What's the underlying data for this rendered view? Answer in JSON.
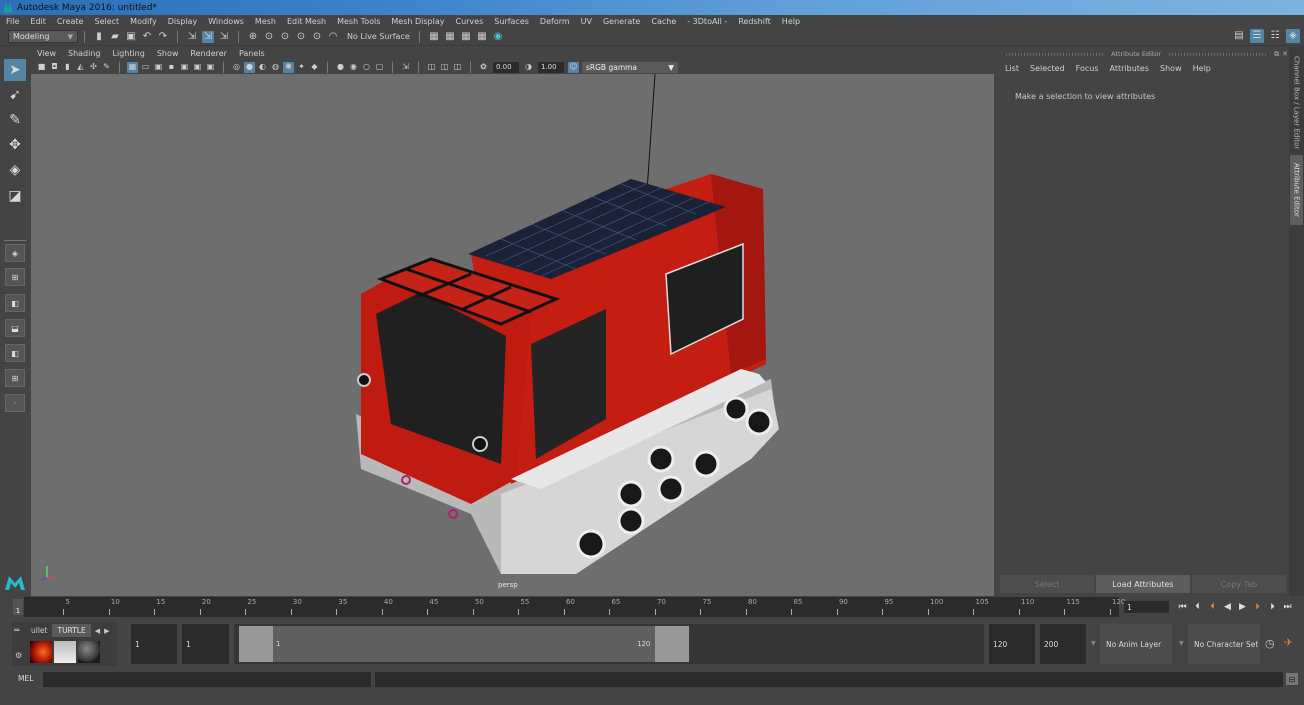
{
  "window": {
    "title": "Autodesk Maya 2016: untitled*"
  },
  "menubar": [
    "File",
    "Edit",
    "Create",
    "Select",
    "Modify",
    "Display",
    "Windows",
    "Mesh",
    "Edit Mesh",
    "Mesh Tools",
    "Mesh Display",
    "Curves",
    "Surfaces",
    "Deform",
    "UV",
    "Generate",
    "Cache",
    "- 3DtoAll -",
    "Redshift",
    "Help"
  ],
  "statusline": {
    "mode": "Modeling",
    "live_surface": "No Live Surface",
    "icons": [
      "new-scene-icon",
      "open-scene-icon",
      "save-scene-icon",
      "undo-icon",
      "redo-icon",
      "select-hierarchy-icon",
      "select-object-icon",
      "select-component-icon",
      "snap-grid-icon",
      "snap-curve-icon",
      "snap-point-icon",
      "snap-view-plane-icon",
      "snap-live-icon",
      "make-live-icon",
      "render-frame-icon",
      "ipr-render-icon",
      "render-settings-icon",
      "hypershade-icon",
      "redshift-icon"
    ],
    "right_icons": [
      "modeling-toolkit-icon",
      "attribute-editor-toggle-icon",
      "tool-settings-icon",
      "channel-box-toggle-icon"
    ]
  },
  "toolbox": {
    "tools": [
      "select-tool",
      "lasso-tool",
      "paint-select-tool",
      "move-tool",
      "rotate-tool",
      "scale-tool"
    ],
    "layouts": [
      "single-perspective-layout",
      "four-view-layout",
      "persp-outliner-layout",
      "persp-graph-layout",
      "persp-hypershade-layout",
      "persp-outliner-graph-layout",
      "layout-more"
    ]
  },
  "viewport": {
    "menu": [
      "View",
      "Shading",
      "Lighting",
      "Show",
      "Renderer",
      "Panels"
    ],
    "exposure": "0.00",
    "gamma": "1.00",
    "color_space": "sRGB gamma",
    "camera_label": "persp"
  },
  "attribute_editor": {
    "title": "Attribute Editor",
    "menu": [
      "List",
      "Selected",
      "Focus",
      "Attributes",
      "Show",
      "Help"
    ],
    "message": "Make a selection to view attributes",
    "buttons": {
      "select": "Select",
      "load": "Load Attributes",
      "copy_tab": "Copy Tab"
    }
  },
  "side_tabs": {
    "channel_box": "Channel Box / Layer Editor",
    "attribute_editor": "Attribute Editor"
  },
  "timeslider": {
    "ticks": [
      5,
      10,
      15,
      20,
      25,
      30,
      35,
      40,
      45,
      50,
      55,
      60,
      65,
      70,
      75,
      80,
      85,
      90,
      95,
      100,
      105,
      110,
      115,
      120
    ],
    "start": 1,
    "end": 120,
    "current_frame": "1",
    "current_marker": "1"
  },
  "playback": [
    "go-to-start-icon",
    "step-back-key-icon",
    "step-back-frame-icon",
    "play-backward-icon",
    "play-forward-icon",
    "step-forward-frame-icon",
    "step-forward-key-icon",
    "go-to-end-icon"
  ],
  "range": {
    "shelf_tabs": [
      "ullet",
      "TURTLE"
    ],
    "shelf_icons": [
      "bullet-fire-icon",
      "turtle-render-icon",
      "sphere-material-icon"
    ],
    "start_frame": "1",
    "range_start": "1",
    "range_handle_start": "1",
    "range_handle_end": "120",
    "range_end": "120",
    "end_frame": "200",
    "anim_layer": "No Anim Layer",
    "character_set": "No Character Set"
  },
  "cmdline": {
    "label": "MEL",
    "value": ""
  }
}
